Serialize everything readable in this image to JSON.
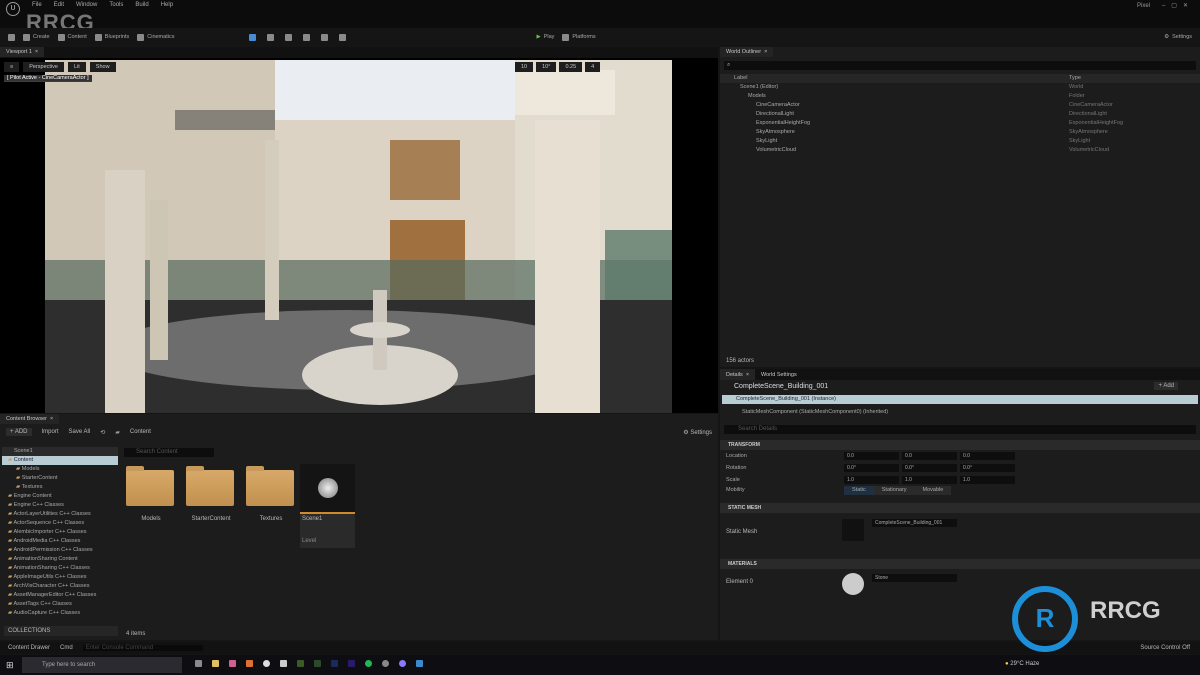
{
  "menu": [
    "File",
    "Edit",
    "Window",
    "Tools",
    "Build",
    "Help"
  ],
  "watermark": "RRCG",
  "user": "Pixel",
  "toolbar": {
    "create": "Create",
    "content": "Content",
    "blueprints": "Blueprints",
    "cinematics": "Cinematics",
    "play": "Play",
    "platforms": "Platforms",
    "settings": "Settings"
  },
  "viewport": {
    "tab": "Viewport 1",
    "perspective": "Perspective",
    "lit": "Lit",
    "show": "Show",
    "pilot": "[ Pilot Active - CineCameraActor ]",
    "grid": "10",
    "angle": "10°",
    "scale": "0.25",
    "speed": "4"
  },
  "outliner": {
    "tab": "World Outliner",
    "col_label": "Label",
    "col_type": "Type",
    "count": "156 actors",
    "items": [
      {
        "label": "Scene1 (Editor)",
        "type": "World"
      },
      {
        "label": "Models",
        "type": "Folder"
      },
      {
        "label": "CineCameraActor",
        "type": "CineCameraActor"
      },
      {
        "label": "DirectionalLight",
        "type": "DirectionalLight"
      },
      {
        "label": "ExponentialHeightFog",
        "type": "ExponentialHeightFog"
      },
      {
        "label": "SkyAtmosphere",
        "type": "SkyAtmosphere"
      },
      {
        "label": "SkyLight",
        "type": "SkyLight"
      },
      {
        "label": "VolumetricCloud",
        "type": "VolumetricCloud"
      }
    ]
  },
  "details": {
    "tab": "Details",
    "tab2": "World Settings",
    "actor": "CompleteScene_Building_001",
    "add": "Add",
    "self": "CompleteScene_Building_001 (Instance)",
    "component": "StaticMeshComponent (StaticMeshComponent0) (Inherited)",
    "search_placeholder": "Search Details",
    "transform": "TRANSFORM",
    "location": "Location",
    "rotation": "Rotation",
    "scale": "Scale",
    "mobility": "Mobility",
    "loc": [
      "0.0",
      "0.0",
      "0.0"
    ],
    "rot": [
      "0.0°",
      "0.0°",
      "0.0°"
    ],
    "scl": [
      "1.0",
      "1.0",
      "1.0"
    ],
    "mobility_opts": [
      "Static",
      "Stationary",
      "Movable"
    ],
    "static_mesh_sec": "STATIC MESH",
    "static_mesh": "Static Mesh",
    "mesh_value": "CompleteScene_Building_001",
    "materials_sec": "MATERIALS",
    "element0": "Element 0",
    "material_value": "Stone"
  },
  "content": {
    "tab": "Content Browser",
    "add": "ADD",
    "import": "Import",
    "save_all": "Save All",
    "path": "Content",
    "settings": "Settings",
    "search_placeholder": "Search Content",
    "count": "4 items",
    "collections": "COLLECTIONS",
    "root": "Scene1",
    "tree": [
      "Content",
      "Models",
      "StarterContent",
      "Textures",
      "Engine Content",
      "Engine C++ Classes",
      "ActorLayerUtilities C++ Classes",
      "ActorSequence C++ Classes",
      "AlembicImporter C++ Classes",
      "AndroidMedia C++ Classes",
      "AndroidPermission C++ Classes",
      "AnimationSharing Content",
      "AnimationSharing C++ Classes",
      "AppleImageUtils C++ Classes",
      "ArchVisCharacter C++ Classes",
      "AssetManagerEditor C++ Classes",
      "AssetTags C++ Classes",
      "AudioCapture C++ Classes"
    ],
    "assets": [
      {
        "name": "Models"
      },
      {
        "name": "StarterContent"
      },
      {
        "name": "Textures"
      }
    ],
    "level": {
      "name": "Scene1",
      "type": "Level"
    }
  },
  "status": {
    "drawer": "Content Drawer",
    "cmd": "Cmd",
    "cmd_placeholder": "Enter Console Command",
    "source_control": "Source Control Off"
  },
  "taskbar": {
    "search": "Type here to search",
    "weather": "29°C Haze"
  }
}
